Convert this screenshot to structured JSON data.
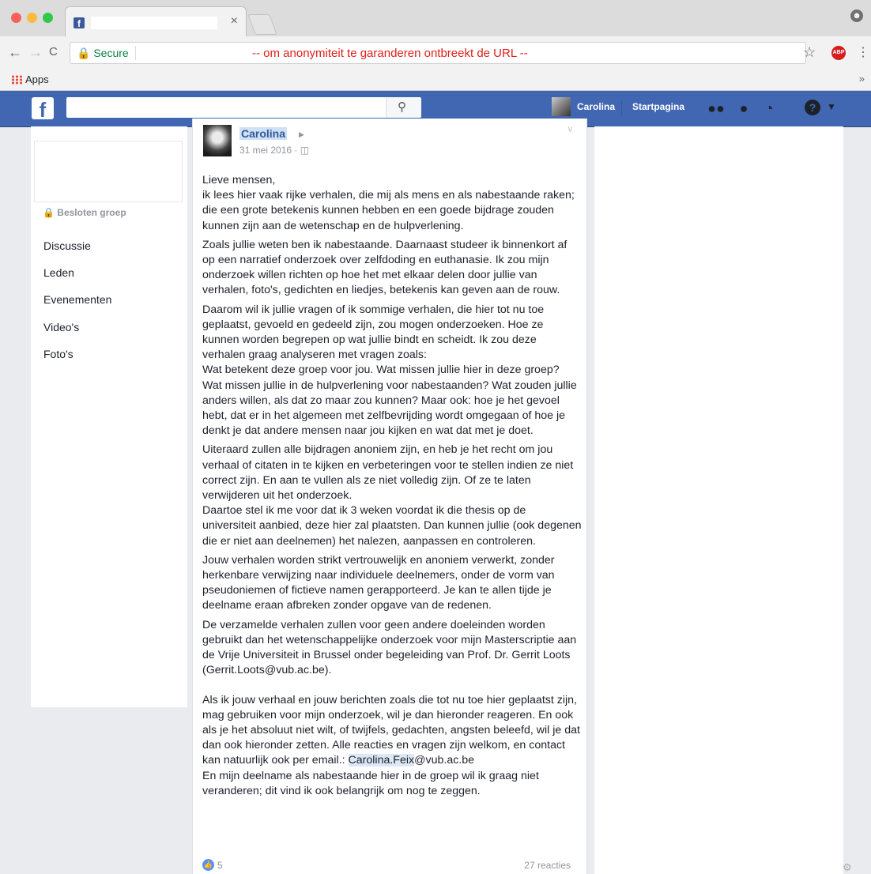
{
  "browser": {
    "tab": {
      "favicon": "f",
      "close": "×"
    },
    "nav": {
      "back": "←",
      "forward": "→",
      "reload": "C"
    },
    "secure_label": "Secure",
    "address_note": "-- om anonymiteit te garanderen ontbreekt de URL --",
    "adblock_label": "ABP",
    "bookmarks": {
      "apps_label": "Apps",
      "more": "»"
    }
  },
  "fb_header": {
    "logo": "f",
    "search_placeholder": "",
    "user_name": "Carolina",
    "home_label": "Startpagina",
    "help": "?"
  },
  "group_sidebar": {
    "privacy": "Besloten groep",
    "nav": [
      "Discussie",
      "Leden",
      "Evenementen",
      "Video's",
      "Foto's"
    ]
  },
  "post": {
    "author": "Carolina",
    "date": "31 mei 2016 ·",
    "paragraphs": [
      "Lieve mensen,\nik lees hier vaak rijke verhalen, die mij als mens en als nabestaande raken; die een grote betekenis kunnen hebben en een goede bijdrage zouden kunnen zijn aan de wetenschap en de hulpverlening.",
      "Zoals jullie weten ben ik nabestaande. Daarnaast studeer ik binnenkort af op een narratief onderzoek over zelfdoding en euthanasie. Ik zou mijn onderzoek willen richten op hoe het met elkaar delen door jullie van verhalen, foto's, gedichten en liedjes, betekenis kan geven aan de rouw.",
      "Daarom wil ik jullie vragen of ik sommige verhalen, die hier tot nu toe geplaatst, gevoeld en gedeeld zijn, zou mogen onderzoeken. Hoe ze kunnen worden begrepen op wat jullie bindt en scheidt. Ik zou deze verhalen graag analyseren met vragen zoals:\nWat betekent deze groep voor jou. Wat missen jullie hier in deze groep? Wat missen jullie in de hulpverlening voor nabestaanden? Wat zouden jullie anders willen, als dat zo maar zou kunnen? Maar ook: hoe je het gevoel hebt, dat er in het algemeen met zelfbevrijding wordt omgegaan of hoe je denkt je dat andere mensen naar jou kijken en wat dat met je doet.",
      "Uiteraard zullen alle bijdragen anoniem zijn, en heb je het recht om jou verhaal of citaten in te kijken en verbeteringen voor te stellen indien ze niet correct zijn. En aan te vullen als ze niet volledig zijn. Of ze te laten verwijderen uit het onderzoek.\nDaartoe stel ik me voor dat ik 3 weken voordat ik die thesis op de universiteit aanbied, deze hier zal plaatsten. Dan kunnen jullie (ook degenen die er niet aan deelnemen) het nalezen, aanpassen en controleren.",
      "Jouw verhalen worden strikt vertrouwelijk en anoniem verwerkt, zonder herkenbare verwijzing naar individuele deelnemers, onder de vorm van pseudoniemen of fictieve namen gerapporteerd. Je kan te allen tijde je deelname eraan afbreken zonder opgave van de redenen.",
      "De verzamelde verhalen zullen voor geen andere doeleinden worden gebruikt dan het wetenschappelijke onderzoek voor mijn Masterscriptie aan de Vrije Universiteit in Brussel onder begeleiding van Prof. Dr. Gerrit Loots (Gerrit.Loots@vub.ac.be)."
    ],
    "closing_before_email": "Als ik jouw verhaal en jouw berichten zoals die tot nu toe hier geplaatst zijn, mag gebruiken voor mijn onderzoek, wil je dan hieronder reageren. En ook als je het absoluut niet wilt, of twijfels, gedachten, angsten beleefd, wil je dat dan ook hieronder zetten. Alle reacties en vragen zijn welkom, en contact kan natuurlijk ook per email.: ",
    "closing_email_highlight": "Carolina.Feix",
    "closing_email_rest": "@vub.ac.be",
    "closing_after": "En mijn deelname als nabestaande hier in de groep wil ik graag niet veranderen; dit vind ik ook belangrijk om nog te zeggen.",
    "likes": "5",
    "reactions": "27 reacties"
  }
}
